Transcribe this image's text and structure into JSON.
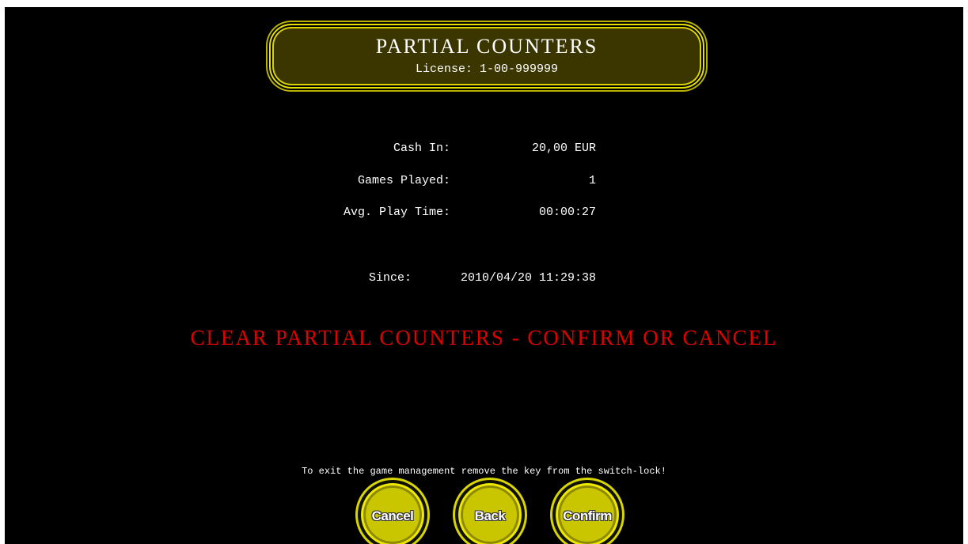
{
  "header": {
    "title": "PARTIAL COUNTERS",
    "license": "License: 1-00-999999"
  },
  "counters": [
    {
      "label": "Cash In:",
      "value": "20,00 EUR"
    },
    {
      "label": "Games Played:",
      "value": "1"
    },
    {
      "label": "Avg. Play Time:",
      "value": "00:00:27"
    }
  ],
  "since": {
    "label": "Since:",
    "value": "2010/04/20 11:29:38"
  },
  "warning": "CLEAR PARTIAL COUNTERS - CONFIRM OR CANCEL",
  "exit_hint": "To exit the game management remove the key from the switch-lock!",
  "buttons": {
    "cancel": "Cancel",
    "back": "Back",
    "confirm": "Confirm"
  },
  "colors": {
    "background": "#000000",
    "accent": "#d8d500",
    "warning": "#e00000",
    "text": "#ffffff"
  }
}
